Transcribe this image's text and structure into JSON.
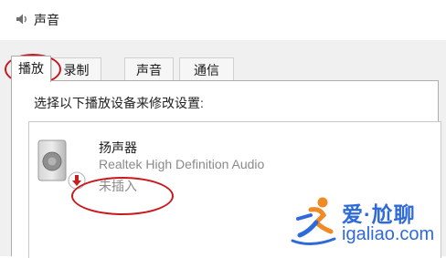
{
  "window": {
    "title": "声音",
    "icon": "speaker-icon"
  },
  "tabs": [
    {
      "label": "播放",
      "active": true
    },
    {
      "label": "录制",
      "active": false
    },
    {
      "label": "声音",
      "active": false
    },
    {
      "label": "通信",
      "active": false
    }
  ],
  "instruction": "选择以下播放设备来修改设置:",
  "devices": [
    {
      "name": "扬声器",
      "description": "Realtek High Definition Audio",
      "status": "未插入",
      "icon": "speaker-device-icon",
      "status_icon": "unplugged-arrow-icon"
    }
  ],
  "watermark": {
    "line1": "爱·尬聊",
    "line2": "igaliao.com"
  },
  "colors": {
    "annotation_red": "#c8191e",
    "watermark_blue": "#2f6bd8",
    "status_gray": "#8a8a8a"
  }
}
